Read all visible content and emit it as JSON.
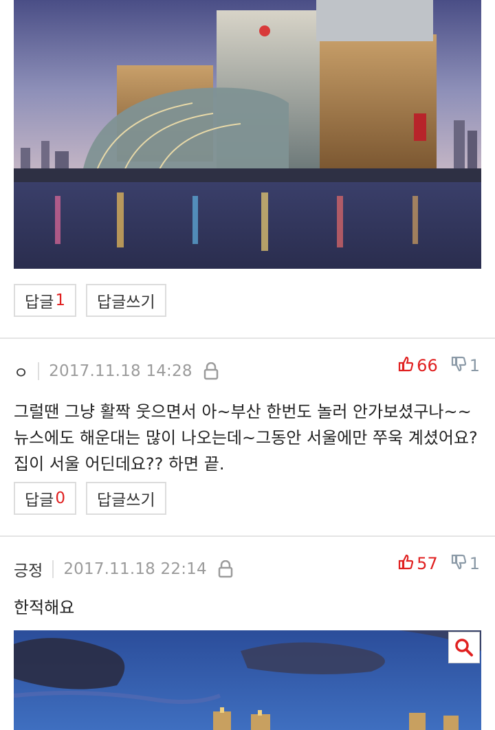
{
  "posts": [
    {
      "reply_label": "답글",
      "reply_count": "1",
      "write_reply_label": "답글쓰기"
    },
    {
      "author": "ㅇ",
      "datetime": "2017.11.18 14:28",
      "up_votes": "66",
      "down_votes": "1",
      "text": "그럴땐 그냥 활짝 웃으면서 아~부산 한번도 놀러 안가보셨구나~~뉴스에도 해운대는 많이 나오는데~그동안 서울에만 쭈욱 계셨어요? 집이 서울 어딘데요?? 하면 끝.",
      "reply_label": "답글",
      "reply_count": "0",
      "write_reply_label": "답글쓰기"
    },
    {
      "author": "긍정",
      "datetime": "2017.11.18 22:14",
      "up_votes": "57",
      "down_votes": "1",
      "text": "한적해요"
    }
  ],
  "icons": {
    "lock": "lock-icon",
    "thumb_up": "thumb-up-icon",
    "thumb_down": "thumb-down-icon",
    "zoom": "magnifier-icon"
  },
  "colors": {
    "accent_red": "#e02020",
    "muted_gray": "#9a9a9a",
    "border": "#dcdcdc"
  }
}
